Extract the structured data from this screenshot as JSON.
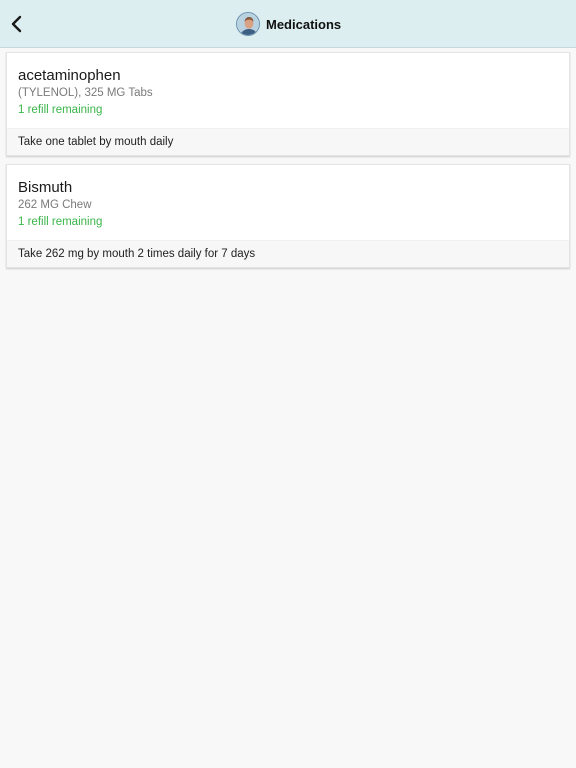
{
  "header": {
    "title": "Medications",
    "back_icon": "chevron-left-icon",
    "avatar_icon": "user-avatar"
  },
  "medications": [
    {
      "name": "acetaminophen",
      "detail": "(TYLENOL), 325 MG Tabs",
      "refill": "1 refill remaining",
      "instructions": "Take one tablet by mouth daily"
    },
    {
      "name": "Bismuth",
      "detail": "262 MG Chew",
      "refill": "1 refill remaining",
      "instructions": "Take 262 mg by mouth 2 times daily for 7 days"
    }
  ],
  "colors": {
    "header_bg": "#ddeef0",
    "refill_green": "#3ab54a"
  }
}
